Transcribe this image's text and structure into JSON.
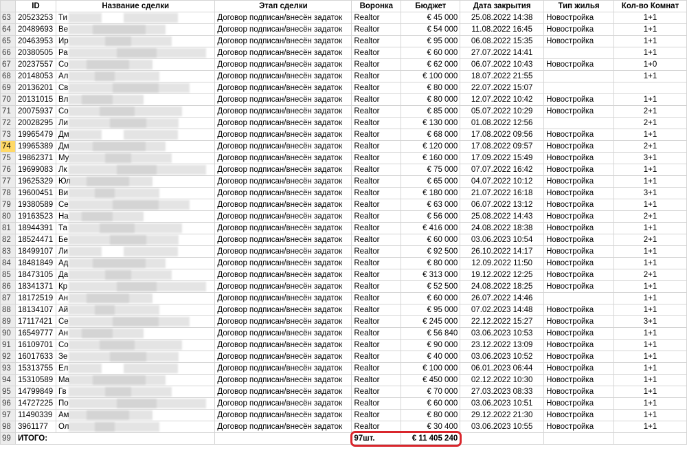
{
  "columns": {
    "id": "ID",
    "name": "Название сделки",
    "stage": "Этап сделки",
    "funnel": "Воронка",
    "budget": "Бюджет",
    "close_date": "Дата закрытия",
    "housing": "Тип жилья",
    "rooms": "Кол-во Комнат"
  },
  "active_row": "74",
  "rows": [
    {
      "n": "63",
      "id": "20523253",
      "name": "Ти",
      "stage": "Договор подписан/внесён задаток",
      "funnel": "Realtor",
      "budget": "€ 45 000",
      "date": "25.08.2022 14:38",
      "housing": "Новостройка",
      "rooms": "1+1"
    },
    {
      "n": "64",
      "id": "20489693",
      "name": "Ве",
      "stage": "Договор подписан/внесён задаток",
      "funnel": "Realtor",
      "budget": "€ 54 000",
      "date": "11.08.2022 16:45",
      "housing": "Новостройка",
      "rooms": "1+1"
    },
    {
      "n": "65",
      "id": "20463953",
      "name": "Ир",
      "stage": "Договор подписан/внесён задаток",
      "funnel": "Realtor",
      "budget": "€ 95 000",
      "date": "06.08.2022 15:35",
      "housing": "Новостройка",
      "rooms": "1+1"
    },
    {
      "n": "66",
      "id": "20380505",
      "name": "Ра",
      "stage": "Договор подписан/внесён задаток",
      "funnel": "Realtor",
      "budget": "€ 60 000",
      "date": "27.07.2022 14:41",
      "housing": "",
      "rooms": "1+1"
    },
    {
      "n": "67",
      "id": "20237557",
      "name": "Со",
      "stage": "Договор подписан/внесён задаток",
      "funnel": "Realtor",
      "budget": "€ 62 000",
      "date": "06.07.2022 10:43",
      "housing": "Новостройка",
      "rooms": "1+0"
    },
    {
      "n": "68",
      "id": "20148053",
      "name": "Ал",
      "stage": "Договор подписан/внесён задаток",
      "funnel": "Realtor",
      "budget": "€ 100 000",
      "date": "18.07.2022 21:55",
      "housing": "",
      "rooms": "1+1"
    },
    {
      "n": "69",
      "id": "20136201",
      "name": "Св",
      "stage": "Договор подписан/внесён задаток",
      "funnel": "Realtor",
      "budget": "€ 80 000",
      "date": "22.07.2022 15:07",
      "housing": "",
      "rooms": ""
    },
    {
      "n": "70",
      "id": "20131015",
      "name": "Вл",
      "stage": "Договор подписан/внесён задаток",
      "funnel": "Realtor",
      "budget": "€ 80 000",
      "date": "12.07.2022 10:42",
      "housing": "Новостройка",
      "rooms": "1+1"
    },
    {
      "n": "71",
      "id": "20075937",
      "name": "Со",
      "stage": "Договор подписан/внесён задаток",
      "funnel": "Realtor",
      "budget": "€ 85 000",
      "date": "05.07.2022 10:29",
      "housing": "Новостройка",
      "rooms": "2+1"
    },
    {
      "n": "72",
      "id": "20028295",
      "name": "Ли",
      "stage": "Договор подписан/внесён задаток",
      "funnel": "Realtor",
      "budget": "€ 130 000",
      "date": "01.08.2022 12:56",
      "housing": "",
      "rooms": "2+1"
    },
    {
      "n": "73",
      "id": "19965479",
      "name": "Дм",
      "stage": "Договор подписан/внесён задаток",
      "funnel": "Realtor",
      "budget": "€ 68 000",
      "date": "17.08.2022 09:56",
      "housing": "Новостройка",
      "rooms": "1+1"
    },
    {
      "n": "74",
      "id": "19965389",
      "name": "Дм",
      "stage": "Договор подписан/внесён задаток",
      "funnel": "Realtor",
      "budget": "€ 120 000",
      "date": "17.08.2022 09:57",
      "housing": "Новостройка",
      "rooms": "2+1"
    },
    {
      "n": "75",
      "id": "19862371",
      "name": "Му",
      "stage": "Договор подписан/внесён задаток",
      "funnel": "Realtor",
      "budget": "€ 160 000",
      "date": "17.09.2022 15:49",
      "housing": "Новостройка",
      "rooms": "3+1"
    },
    {
      "n": "76",
      "id": "19699083",
      "name": "Лк",
      "stage": "Договор подписан/внесён задаток",
      "funnel": "Realtor",
      "budget": "€ 75 000",
      "date": "07.07.2022 16:42",
      "housing": "Новостройка",
      "rooms": "1+1"
    },
    {
      "n": "77",
      "id": "19625329",
      "name": "Юл",
      "stage": "Договор подписан/внесён задаток",
      "funnel": "Realtor",
      "budget": "€ 65 000",
      "date": "04.07.2022 10:12",
      "housing": "Новостройка",
      "rooms": "1+1"
    },
    {
      "n": "78",
      "id": "19600451",
      "name": "Ви",
      "stage": "Договор подписан/внесён задаток",
      "funnel": "Realtor",
      "budget": "€ 180 000",
      "date": "21.07.2022 16:18",
      "housing": "Новостройка",
      "rooms": "3+1"
    },
    {
      "n": "79",
      "id": "19380589",
      "name": "Се",
      "stage": "Договор подписан/внесён задаток",
      "funnel": "Realtor",
      "budget": "€ 63 000",
      "date": "06.07.2022 13:12",
      "housing": "Новостройка",
      "rooms": "1+1"
    },
    {
      "n": "80",
      "id": "19163523",
      "name": "На",
      "stage": "Договор подписан/внесён задаток",
      "funnel": "Realtor",
      "budget": "€ 56 000",
      "date": "25.08.2022 14:43",
      "housing": "Новостройка",
      "rooms": "2+1"
    },
    {
      "n": "81",
      "id": "18944391",
      "name": "Та",
      "stage": "Договор подписан/внесён задаток",
      "funnel": "Realtor",
      "budget": "€ 416 000",
      "date": "24.08.2022 18:38",
      "housing": "Новостройка",
      "rooms": "1+1"
    },
    {
      "n": "82",
      "id": "18524471",
      "name": "Бе",
      "stage": "Договор подписан/внесён задаток",
      "funnel": "Realtor",
      "budget": "€ 60 000",
      "date": "03.06.2023 10:54",
      "housing": "Новостройка",
      "rooms": "2+1"
    },
    {
      "n": "83",
      "id": "18499107",
      "name": "Ли",
      "stage": "Договор подписан/внесён задаток",
      "funnel": "Realtor",
      "budget": "€ 92 500",
      "date": "26.10.2022 14:17",
      "housing": "Новостройка",
      "rooms": "1+1"
    },
    {
      "n": "84",
      "id": "18481849",
      "name": "Ад",
      "stage": "Договор подписан/внесён задаток",
      "funnel": "Realtor",
      "budget": "€ 80 000",
      "date": "12.09.2022 11:50",
      "housing": "Новостройка",
      "rooms": "1+1"
    },
    {
      "n": "85",
      "id": "18473105",
      "name": "Да",
      "stage": "Договор подписан/внесён задаток",
      "funnel": "Realtor",
      "budget": "€ 313 000",
      "date": "19.12.2022 12:25",
      "housing": "Новостройка",
      "rooms": "2+1"
    },
    {
      "n": "86",
      "id": "18341371",
      "name": "Кр",
      "stage": "Договор подписан/внесён задаток",
      "funnel": "Realtor",
      "budget": "€ 52 500",
      "date": "24.08.2022 18:25",
      "housing": "Новостройка",
      "rooms": "1+1"
    },
    {
      "n": "87",
      "id": "18172519",
      "name": "Ан",
      "stage": "Договор подписан/внесён задаток",
      "funnel": "Realtor",
      "budget": "€ 60 000",
      "date": "26.07.2022 14:46",
      "housing": "",
      "rooms": "1+1"
    },
    {
      "n": "88",
      "id": "18134107",
      "name": "Ай",
      "stage": "Договор подписан/внесён задаток",
      "funnel": "Realtor",
      "budget": "€ 95 000",
      "date": "07.02.2023 14:48",
      "housing": "Новостройка",
      "rooms": "1+1"
    },
    {
      "n": "89",
      "id": "17117421",
      "name": "Се",
      "stage": "Договор подписан/внесён задаток",
      "funnel": "Realtor",
      "budget": "€ 245 000",
      "date": "22.12.2022 15:27",
      "housing": "Новостройка",
      "rooms": "3+1"
    },
    {
      "n": "90",
      "id": "16549777",
      "name": "Ан",
      "stage": "Договор подписан/внесён задаток",
      "funnel": "Realtor",
      "budget": "€ 56 840",
      "date": "03.06.2023 10:53",
      "housing": "Новостройка",
      "rooms": "1+1"
    },
    {
      "n": "91",
      "id": "16109701",
      "name": "Со",
      "stage": "Договор подписан/внесён задаток",
      "funnel": "Realtor",
      "budget": "€ 90 000",
      "date": "23.12.2022 13:09",
      "housing": "Новостройка",
      "rooms": "1+1"
    },
    {
      "n": "92",
      "id": "16017633",
      "name": "Зе",
      "stage": "Договор подписан/внесён задаток",
      "funnel": "Realtor",
      "budget": "€ 40 000",
      "date": "03.06.2023 10:52",
      "housing": "Новостройка",
      "rooms": "1+1"
    },
    {
      "n": "93",
      "id": "15313755",
      "name": "Ел",
      "stage": "Договор подписан/внесён задаток",
      "funnel": "Realtor",
      "budget": "€ 100 000",
      "date": "06.01.2023 06:44",
      "housing": "Новостройка",
      "rooms": "1+1"
    },
    {
      "n": "94",
      "id": "15310589",
      "name": "Ма",
      "stage": "Договор подписан/внесён задаток",
      "funnel": "Realtor",
      "budget": "€ 450 000",
      "date": "02.12.2022 10:30",
      "housing": "Новостройка",
      "rooms": "1+1"
    },
    {
      "n": "95",
      "id": "14799849",
      "name": "Гв",
      "stage": "Договор подписан/внесён задаток",
      "funnel": "Realtor",
      "budget": "€ 70 000",
      "date": "27.03.2023 08:33",
      "housing": "Новостройка",
      "rooms": "1+1"
    },
    {
      "n": "96",
      "id": "14727225",
      "name": "По",
      "stage": "Договор подписан/внесён задаток",
      "funnel": "Realtor",
      "budget": "€ 60 000",
      "date": "03.06.2023 10:51",
      "housing": "Новостройка",
      "rooms": "1+1"
    },
    {
      "n": "97",
      "id": "11490339",
      "name": "Ам",
      "stage": "Договор подписан/внесён задаток",
      "funnel": "Realtor",
      "budget": "€ 80 000",
      "date": "29.12.2022 21:30",
      "housing": "Новостройка",
      "rooms": "1+1"
    },
    {
      "n": "98",
      "id": "3961177",
      "name": "Ол",
      "stage": "Договор подписан/внесён задаток",
      "funnel": "Realtor",
      "budget": "€ 30 400",
      "date": "03.06.2023 10:55",
      "housing": "Новостройка",
      "rooms": "1+1"
    }
  ],
  "totals": {
    "n": "99",
    "label": "ИТОГО:",
    "count": "97шт.",
    "budget": "€ 11 405 240"
  },
  "colors": {
    "highlight": "#d9262c",
    "active_row_header": "#ffd966",
    "row_header": "#ececec"
  }
}
